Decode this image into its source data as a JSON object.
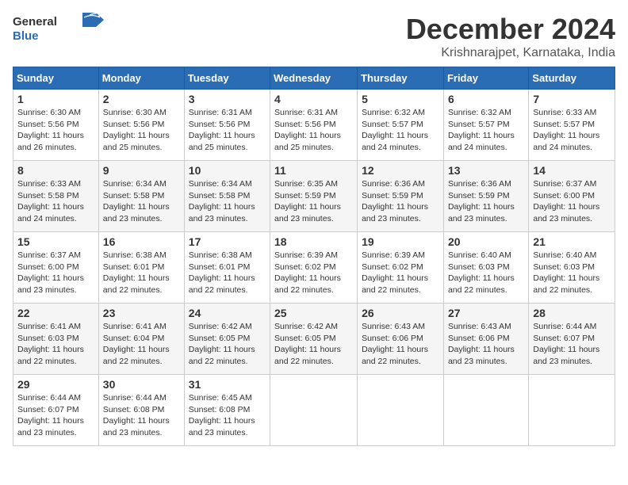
{
  "header": {
    "logo_general": "General",
    "logo_blue": "Blue",
    "month_title": "December 2024",
    "location": "Krishnarajpet, Karnataka, India"
  },
  "calendar": {
    "days_of_week": [
      "Sunday",
      "Monday",
      "Tuesday",
      "Wednesday",
      "Thursday",
      "Friday",
      "Saturday"
    ],
    "weeks": [
      [
        {
          "day": "1",
          "info": "Sunrise: 6:30 AM\nSunset: 5:56 PM\nDaylight: 11 hours\nand 26 minutes."
        },
        {
          "day": "2",
          "info": "Sunrise: 6:30 AM\nSunset: 5:56 PM\nDaylight: 11 hours\nand 25 minutes."
        },
        {
          "day": "3",
          "info": "Sunrise: 6:31 AM\nSunset: 5:56 PM\nDaylight: 11 hours\nand 25 minutes."
        },
        {
          "day": "4",
          "info": "Sunrise: 6:31 AM\nSunset: 5:56 PM\nDaylight: 11 hours\nand 25 minutes."
        },
        {
          "day": "5",
          "info": "Sunrise: 6:32 AM\nSunset: 5:57 PM\nDaylight: 11 hours\nand 24 minutes."
        },
        {
          "day": "6",
          "info": "Sunrise: 6:32 AM\nSunset: 5:57 PM\nDaylight: 11 hours\nand 24 minutes."
        },
        {
          "day": "7",
          "info": "Sunrise: 6:33 AM\nSunset: 5:57 PM\nDaylight: 11 hours\nand 24 minutes."
        }
      ],
      [
        {
          "day": "8",
          "info": "Sunrise: 6:33 AM\nSunset: 5:58 PM\nDaylight: 11 hours\nand 24 minutes."
        },
        {
          "day": "9",
          "info": "Sunrise: 6:34 AM\nSunset: 5:58 PM\nDaylight: 11 hours\nand 23 minutes."
        },
        {
          "day": "10",
          "info": "Sunrise: 6:34 AM\nSunset: 5:58 PM\nDaylight: 11 hours\nand 23 minutes."
        },
        {
          "day": "11",
          "info": "Sunrise: 6:35 AM\nSunset: 5:59 PM\nDaylight: 11 hours\nand 23 minutes."
        },
        {
          "day": "12",
          "info": "Sunrise: 6:36 AM\nSunset: 5:59 PM\nDaylight: 11 hours\nand 23 minutes."
        },
        {
          "day": "13",
          "info": "Sunrise: 6:36 AM\nSunset: 5:59 PM\nDaylight: 11 hours\nand 23 minutes."
        },
        {
          "day": "14",
          "info": "Sunrise: 6:37 AM\nSunset: 6:00 PM\nDaylight: 11 hours\nand 23 minutes."
        }
      ],
      [
        {
          "day": "15",
          "info": "Sunrise: 6:37 AM\nSunset: 6:00 PM\nDaylight: 11 hours\nand 23 minutes."
        },
        {
          "day": "16",
          "info": "Sunrise: 6:38 AM\nSunset: 6:01 PM\nDaylight: 11 hours\nand 22 minutes."
        },
        {
          "day": "17",
          "info": "Sunrise: 6:38 AM\nSunset: 6:01 PM\nDaylight: 11 hours\nand 22 minutes."
        },
        {
          "day": "18",
          "info": "Sunrise: 6:39 AM\nSunset: 6:02 PM\nDaylight: 11 hours\nand 22 minutes."
        },
        {
          "day": "19",
          "info": "Sunrise: 6:39 AM\nSunset: 6:02 PM\nDaylight: 11 hours\nand 22 minutes."
        },
        {
          "day": "20",
          "info": "Sunrise: 6:40 AM\nSunset: 6:03 PM\nDaylight: 11 hours\nand 22 minutes."
        },
        {
          "day": "21",
          "info": "Sunrise: 6:40 AM\nSunset: 6:03 PM\nDaylight: 11 hours\nand 22 minutes."
        }
      ],
      [
        {
          "day": "22",
          "info": "Sunrise: 6:41 AM\nSunset: 6:03 PM\nDaylight: 11 hours\nand 22 minutes."
        },
        {
          "day": "23",
          "info": "Sunrise: 6:41 AM\nSunset: 6:04 PM\nDaylight: 11 hours\nand 22 minutes."
        },
        {
          "day": "24",
          "info": "Sunrise: 6:42 AM\nSunset: 6:05 PM\nDaylight: 11 hours\nand 22 minutes."
        },
        {
          "day": "25",
          "info": "Sunrise: 6:42 AM\nSunset: 6:05 PM\nDaylight: 11 hours\nand 22 minutes."
        },
        {
          "day": "26",
          "info": "Sunrise: 6:43 AM\nSunset: 6:06 PM\nDaylight: 11 hours\nand 22 minutes."
        },
        {
          "day": "27",
          "info": "Sunrise: 6:43 AM\nSunset: 6:06 PM\nDaylight: 11 hours\nand 23 minutes."
        },
        {
          "day": "28",
          "info": "Sunrise: 6:44 AM\nSunset: 6:07 PM\nDaylight: 11 hours\nand 23 minutes."
        }
      ],
      [
        {
          "day": "29",
          "info": "Sunrise: 6:44 AM\nSunset: 6:07 PM\nDaylight: 11 hours\nand 23 minutes."
        },
        {
          "day": "30",
          "info": "Sunrise: 6:44 AM\nSunset: 6:08 PM\nDaylight: 11 hours\nand 23 minutes."
        },
        {
          "day": "31",
          "info": "Sunrise: 6:45 AM\nSunset: 6:08 PM\nDaylight: 11 hours\nand 23 minutes."
        },
        {
          "day": "",
          "info": ""
        },
        {
          "day": "",
          "info": ""
        },
        {
          "day": "",
          "info": ""
        },
        {
          "day": "",
          "info": ""
        }
      ]
    ]
  }
}
